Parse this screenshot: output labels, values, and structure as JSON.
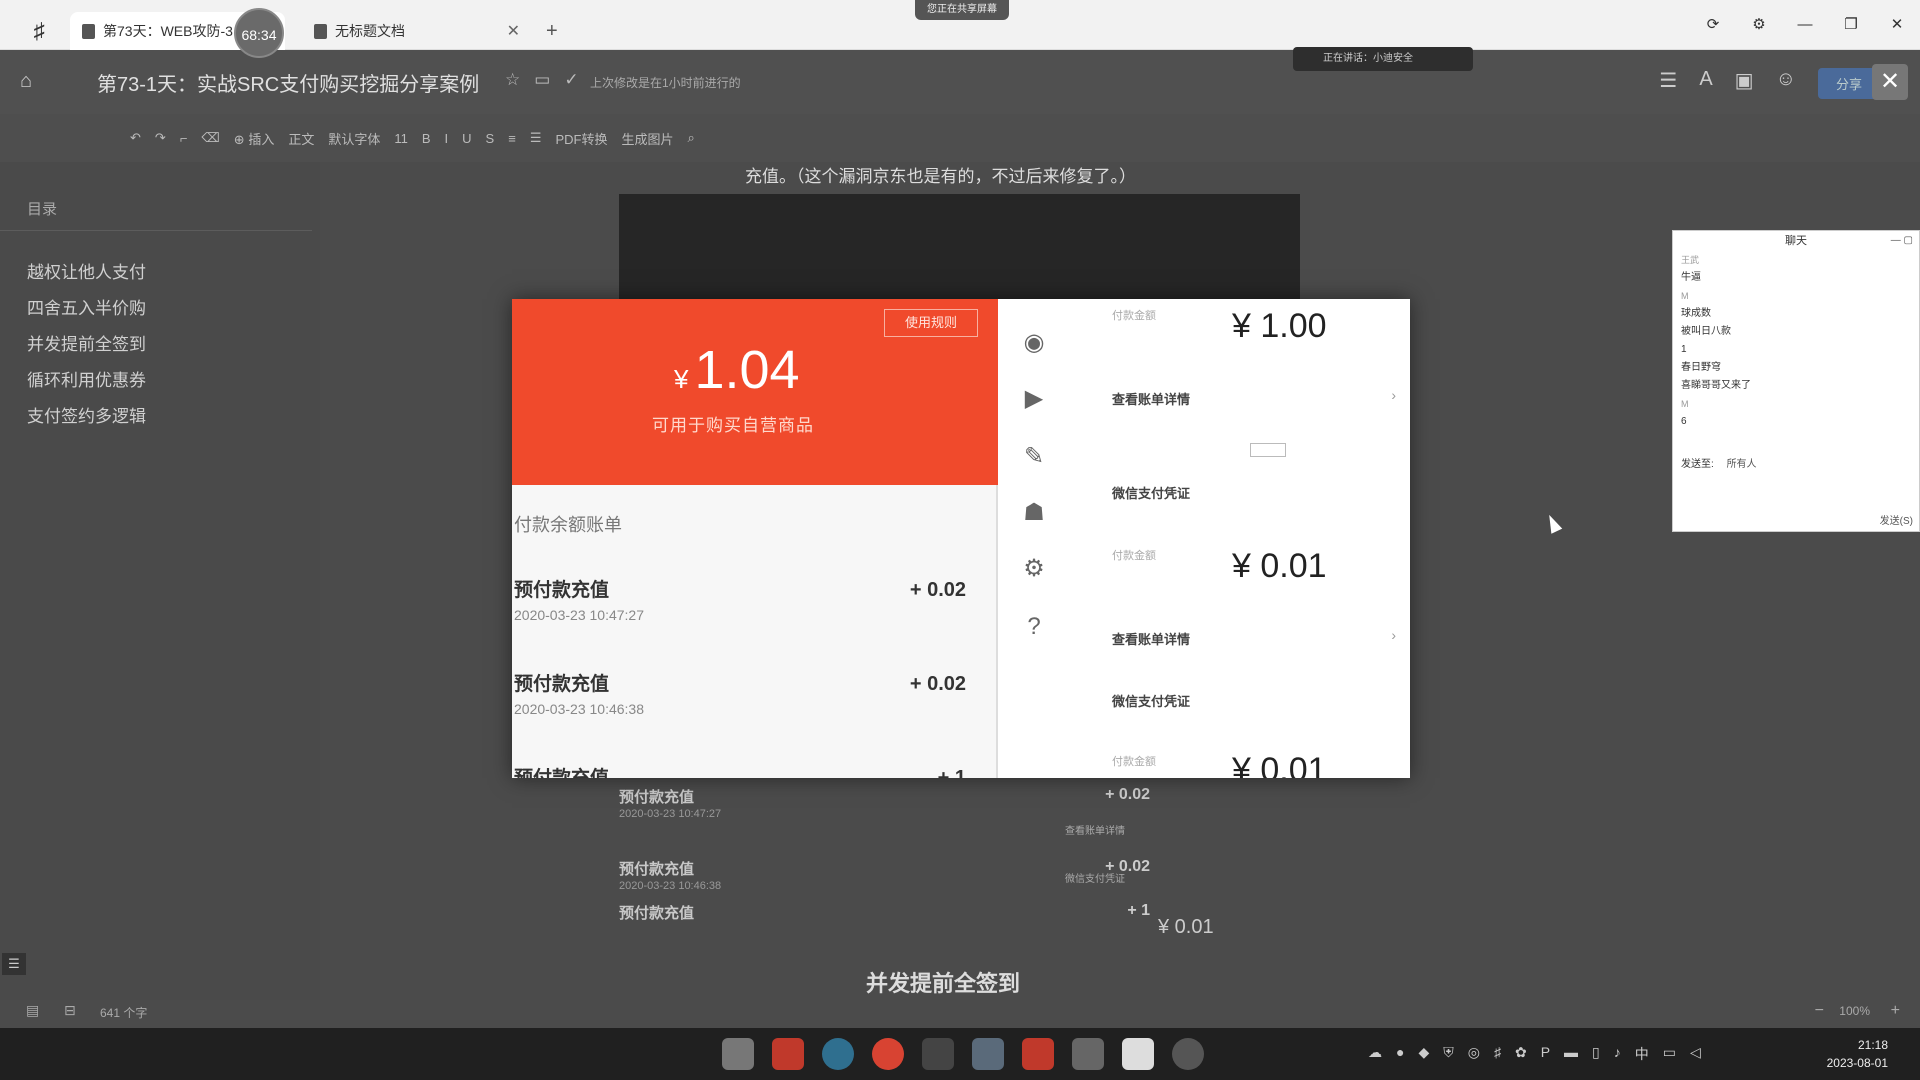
{
  "tabs": [
    {
      "label": "第73天：WEB攻防-3"
    },
    {
      "label": "无标题文档"
    }
  ],
  "timer": "68:34",
  "share_status": "您正在共享屏幕",
  "notify": "正在讲话：小迪安全",
  "doc": {
    "title": "第73-1天：实战SRC支付购买挖掘分享案例",
    "saved_note": "上次修改是在1小时前进行的",
    "share_button": "分享",
    "top_line": "充值。（这个漏洞京东也是有的，不过后来修复了。）",
    "section_heading": "并发提前全签到"
  },
  "toolbar": {
    "insert": "插入",
    "style": "正文",
    "font": "默认字体",
    "size": "11",
    "pdf": "PDF转换",
    "image": "生成图片"
  },
  "toc": {
    "title": "目录",
    "items": [
      "越权让他人支付",
      "四舍五入半价购",
      "并发提前全签到",
      "循环利用优惠券",
      "支付签约多逻辑"
    ]
  },
  "popup": {
    "rule_button": "使用规则",
    "balance_yen": "¥",
    "balance": "1.04",
    "balance_sub": "可用于购买自营商品",
    "bill_title": "付款余额账单",
    "bills": [
      {
        "name": "预付款充值",
        "date": "2020-03-23 10:47:27",
        "amount": "+ 0.02"
      },
      {
        "name": "预付款充值",
        "date": "2020-03-23 10:46:38",
        "amount": "+ 0.02"
      },
      {
        "name": "预付款充值",
        "date": "",
        "amount": "+ 1"
      }
    ],
    "right": [
      {
        "label": "付款金额",
        "amount": "¥ 1.00",
        "link": "查看账单详情",
        "voucher": "微信支付凭证"
      },
      {
        "label": "付款金额",
        "amount": "¥ 0.01",
        "link": "查看账单详情",
        "voucher": "微信支付凭证"
      },
      {
        "label": "付款金额",
        "amount": "¥ 0.01"
      }
    ]
  },
  "bg_list": [
    {
      "name": "预付款充值",
      "date": "2020-03-23 10:47:27",
      "amount": "+ 0.02"
    },
    {
      "name": "预付款充值",
      "date": "2020-03-23 10:46:38",
      "amount": "+ 0.02"
    },
    {
      "name": "预付款充值",
      "date": "",
      "amount": "+ 1"
    }
  ],
  "bg_right": {
    "link1": "查看账单详情",
    "link2": "微信支付凭证",
    "amount": "¥ 0.01"
  },
  "chat": {
    "title": "聊天",
    "messages": [
      {
        "sender": "王武",
        "text": "牛逼"
      },
      {
        "sender": "M",
        "text": "球成数"
      },
      {
        "sender": "",
        "text": "被叫日八款"
      },
      {
        "sender": "",
        "text": "1"
      },
      {
        "sender": "",
        "text": "春日野穹"
      },
      {
        "sender": "",
        "text": "喜睇哥哥又来了"
      },
      {
        "sender": "M",
        "text": "6"
      }
    ],
    "send_to_label": "发送至:",
    "send_to_value": "所有人",
    "send_button": "发送(S)"
  },
  "status": {
    "word_count": "641 个字",
    "zoom": "100%"
  },
  "clock": {
    "time": "21:18",
    "date": "2023-08-01"
  },
  "tray_ime": "中",
  "colors": {
    "accent_red": "#f04a2c",
    "taskbar": "#202020"
  }
}
